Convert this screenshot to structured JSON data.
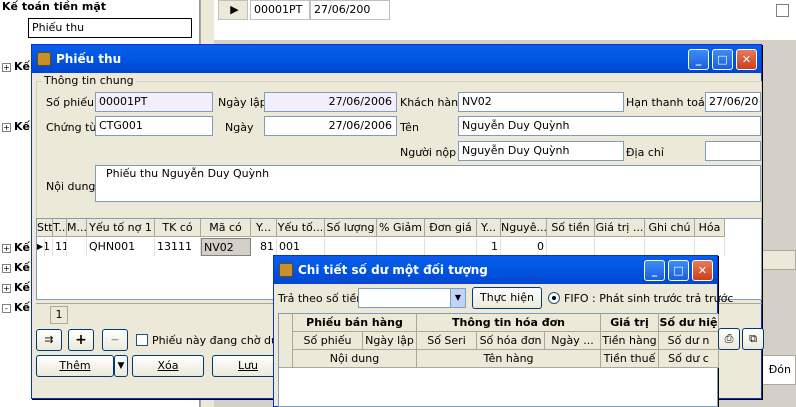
{
  "background": {
    "tree_header": "Kế toán tiền mặt",
    "tree_selected": "Phiếu thu",
    "tree_nodes": [
      "Kế",
      "Kế",
      "Kế",
      "Kế",
      "Kế",
      "Kế"
    ],
    "grid_row": {
      "so_phieu": "00001PT",
      "ngay": "27/06/200"
    }
  },
  "phieu_thu": {
    "title": "Phiếu thu",
    "group_label": "Thông tin chung",
    "so_phieu_label": "Số phiếu",
    "so_phieu_value": "00001PT",
    "ngay_lap_label": "Ngày lập",
    "ngay_lap_value": "27/06/2006",
    "khach_hang_label": "Khách hàng",
    "khach_hang_value": "NV02",
    "han_thanh_toan_label": "Hạn thanh toán",
    "han_thanh_toan_value": "27/06/20",
    "chung_tu_label": "Chứng từ",
    "chung_tu_value": "CTG001",
    "ngay_label": "Ngày",
    "ngay_value": "27/06/2006",
    "ten_label": "Tên",
    "ten_value": "Nguyễn Duy Quỳnh",
    "nguoi_nop_label": "Người nộp",
    "nguoi_nop_value": "Nguyễn Duy Quỳnh",
    "dia_chi_label": "Địa chỉ",
    "dia_chi_value": "",
    "noi_dung_label": "Nội dung",
    "noi_dung_value": "Phiếu thu Nguyễn Duy Quỳnh",
    "grid_headers": [
      "Stt",
      "T...",
      "M...",
      "Yếu tố nợ 1",
      "TK có",
      "Mã có",
      "Y...",
      "Yếu tố...",
      "Số lượng",
      "% Giảm",
      "Đơn giá",
      "Y...",
      "Nguyê...",
      "Số tiền",
      "Giá trị ...",
      "Ghi chú",
      "Hóa"
    ],
    "grid_row": [
      "1",
      "111",
      "",
      "QHN001",
      "13111",
      "NV02",
      "81",
      "001",
      "",
      "",
      "",
      "1",
      "0",
      "",
      "",
      "",
      ""
    ],
    "page_number": "1",
    "pending_checkbox_label": "Phiếu này đang chờ duyệt",
    "add_button": "Thêm",
    "delete_button": "Xóa",
    "save_button": "Lưu"
  },
  "chi_tiet": {
    "title": "Chi tiết số dư một đối tượng",
    "tra_theo_label": "Trả theo số tiền",
    "tra_theo_value": "",
    "thuc_hien_button": "Thực hiện",
    "fifo_label": "FIFO : Phát sinh trước trả trước",
    "group_headers": [
      "Phiếu bán hàng",
      "Thông tin hóa đơn",
      "Giá trị",
      "Số dư hiệ"
    ],
    "sub_headers": [
      "Số phiếu",
      "Ngày lập",
      "Số Seri",
      "Số hóa đơn",
      "Ngày ...",
      "Tiền hàng",
      "Số dư n"
    ],
    "sub_headers2": [
      "Nội dung",
      "Tên hàng",
      "Tiền thuế",
      "Số dư c"
    ]
  },
  "behind_label": "Đón"
}
